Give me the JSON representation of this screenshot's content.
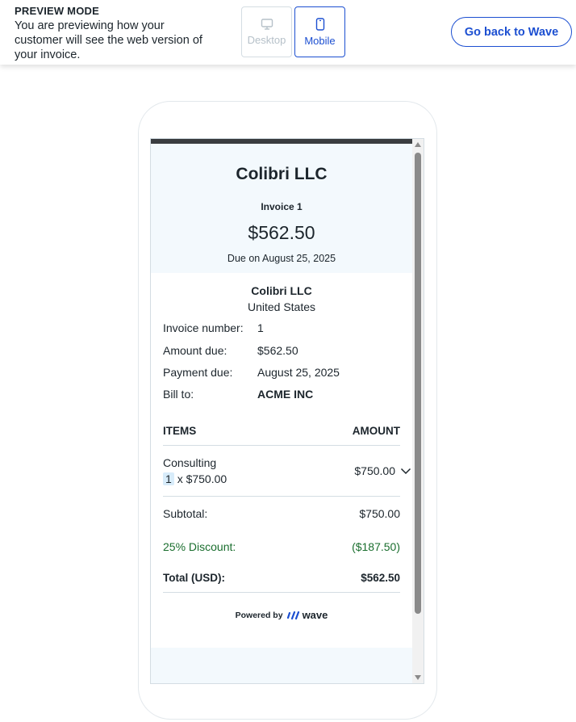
{
  "preview": {
    "title": "PREVIEW MODE",
    "description": "You are previewing how your customer will see the web version of your invoice.",
    "desktop_label": "Desktop",
    "mobile_label": "Mobile",
    "back_label": "Go back to Wave"
  },
  "invoice": {
    "company": "Colibri LLC",
    "invoice_label": "Invoice 1",
    "amount": "$562.50",
    "due_line": "Due on August 25, 2025",
    "from_name": "Colibri LLC",
    "from_country": "United States",
    "details": [
      {
        "label": "Invoice number:",
        "value": "1"
      },
      {
        "label": "Amount due:",
        "value": "$562.50"
      },
      {
        "label": "Payment due:",
        "value": "August 25, 2025"
      },
      {
        "label": "Bill to:",
        "value": "ACME INC"
      }
    ],
    "items_header": "ITEMS",
    "amount_header": "AMOUNT",
    "item": {
      "name": "Consulting",
      "qty": "1",
      "qty_suffix": "x $750.00",
      "amount": "$750.00"
    },
    "subtotal_label": "Subtotal:",
    "subtotal_value": "$750.00",
    "discount_label": "25% Discount:",
    "discount_value": "($187.50)",
    "total_label": "Total (USD):",
    "total_value": "$562.50",
    "powered_by": "Powered by",
    "brand": "wave"
  },
  "colors": {
    "accent": "#1c4fd1",
    "discount": "#1a6e2e",
    "header_bg": "#f3f9fd"
  }
}
